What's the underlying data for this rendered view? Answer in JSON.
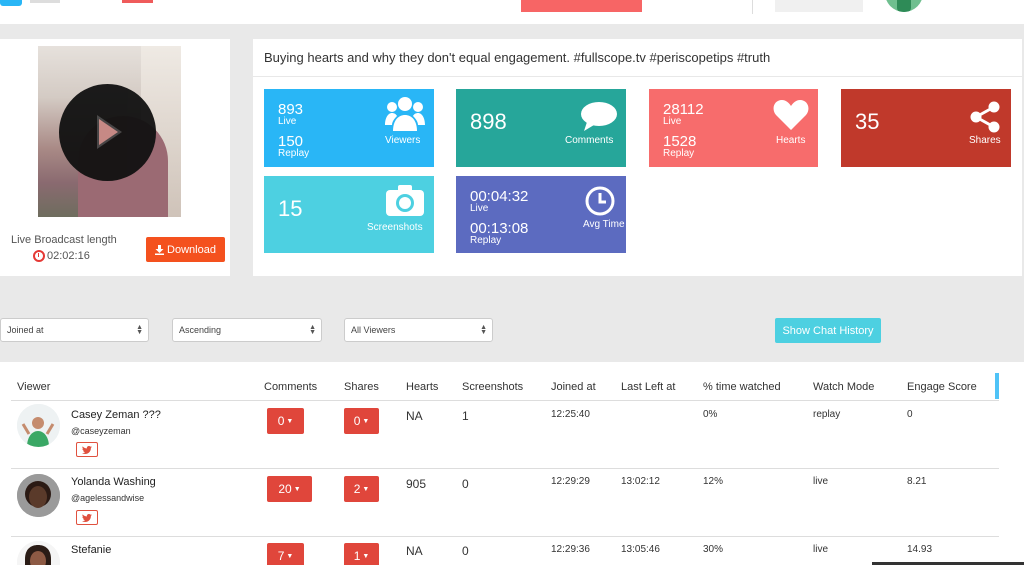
{
  "broadcast": {
    "title": "Buying hearts and why they don't equal engagement. #fullscope.tv #periscopetips #truth",
    "length_label": "Live Broadcast length",
    "length_value": "02:02:16",
    "download_label": "Download"
  },
  "stats": {
    "viewers": {
      "live": "893",
      "live_label": "Live",
      "replay": "150",
      "replay_label": "Replay",
      "caption": "Viewers",
      "color": "#29b6f6"
    },
    "comments": {
      "value": "898",
      "caption": "Comments",
      "color": "#26a69a"
    },
    "hearts": {
      "live": "28112",
      "live_label": "Live",
      "replay": "1528",
      "replay_label": "Replay",
      "caption": "Hearts",
      "color": "#f76c6c"
    },
    "shares": {
      "value": "35",
      "caption": "Shares",
      "color": "#c0392b"
    },
    "screenshots": {
      "value": "15",
      "caption": "Screenshots",
      "color": "#4dd0e1"
    },
    "avg_time": {
      "live": "00:04:32",
      "live_label": "Live",
      "replay": "00:13:08",
      "replay_label": "Replay",
      "caption": "Avg Time",
      "color": "#5c6bc0"
    }
  },
  "filters": {
    "sort_by": "Joined at",
    "order": "Ascending",
    "viewers": "All Viewers",
    "chat_history_label": "Show Chat History"
  },
  "table": {
    "headers": {
      "viewer": "Viewer",
      "comments": "Comments",
      "shares": "Shares",
      "hearts": "Hearts",
      "screenshots": "Screenshots",
      "joined_at": "Joined at",
      "last_left_at": "Last Left at",
      "pct_watched": "% time watched",
      "watch_mode": "Watch Mode",
      "engage_score": "Engage Score"
    },
    "rows": [
      {
        "name": "Casey Zeman ???",
        "handle": "@caseyzeman",
        "comments": "0",
        "shares": "0",
        "hearts": "NA",
        "screenshots": "1",
        "joined_at": "12:25:40",
        "last_left_at": "",
        "pct_watched": "0%",
        "watch_mode": "replay",
        "engage_score": "0"
      },
      {
        "name": "Yolanda Washing",
        "handle": "@agelessandwise",
        "comments": "20",
        "shares": "2",
        "hearts": "905",
        "screenshots": "0",
        "joined_at": "12:29:29",
        "last_left_at": "13:02:12",
        "pct_watched": "12%",
        "watch_mode": "live",
        "engage_score": "8.21"
      },
      {
        "name": "Stefanie",
        "handle": "",
        "comments": "7",
        "shares": "1",
        "hearts": "NA",
        "screenshots": "0",
        "joined_at": "12:29:36",
        "last_left_at": "13:05:46",
        "pct_watched": "30%",
        "watch_mode": "live",
        "engage_score": "14.93"
      }
    ]
  }
}
